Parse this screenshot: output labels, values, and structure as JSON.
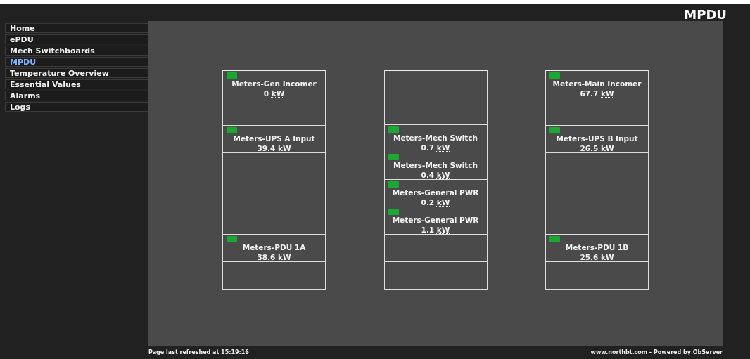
{
  "header": {
    "title": "MPDU"
  },
  "sidebar": {
    "items": [
      {
        "label": "Home",
        "selected": false
      },
      {
        "label": "ePDU",
        "selected": false
      },
      {
        "label": "Mech Switchboards",
        "selected": false
      },
      {
        "label": "MPDU",
        "selected": true
      },
      {
        "label": "Temperature Overview",
        "selected": false
      },
      {
        "label": "Essential Values",
        "selected": false
      },
      {
        "label": "Alarms",
        "selected": false
      },
      {
        "label": "Logs",
        "selected": false
      }
    ]
  },
  "columns": [
    {
      "cells": [
        {
          "kind": "meter",
          "color": "#1aa832",
          "name": "Meters-Gen Incomer",
          "value": "0",
          "unit": "kW"
        },
        {
          "kind": "empty"
        },
        {
          "kind": "meter",
          "color": "#1aa832",
          "name": "Meters-UPS A Input",
          "value": "39.4",
          "unit": "kW"
        },
        {
          "kind": "empty-triple"
        },
        {
          "kind": "meter",
          "color": "#1aa832",
          "name": "Meters-PDU 1A",
          "value": "38.6",
          "unit": "kW"
        },
        {
          "kind": "empty"
        }
      ]
    },
    {
      "cells": [
        {
          "kind": "empty-double"
        },
        {
          "kind": "meter",
          "color": "#1aa832",
          "name": "Meters-Mech Switch",
          "value": "0.7",
          "unit": "kW"
        },
        {
          "kind": "meter",
          "color": "#1aa832",
          "name": "Meters-Mech Switch",
          "value": "0.4",
          "unit": "kW"
        },
        {
          "kind": "meter",
          "color": "#1aa832",
          "name": "Meters-General PWR",
          "value": "0.2",
          "unit": "kW"
        },
        {
          "kind": "meter",
          "color": "#1aa832",
          "name": "Meters-General PWR",
          "value": "1.1",
          "unit": "kW"
        },
        {
          "kind": "empty"
        },
        {
          "kind": "empty"
        }
      ]
    },
    {
      "cells": [
        {
          "kind": "meter",
          "color": "#1aa832",
          "name": "Meters-Main Incomer",
          "value": "67.7",
          "unit": "kW"
        },
        {
          "kind": "empty"
        },
        {
          "kind": "meter",
          "color": "#1aa832",
          "name": "Meters-UPS B Input",
          "value": "26.5",
          "unit": "kW"
        },
        {
          "kind": "empty-triple"
        },
        {
          "kind": "meter",
          "color": "#1aa832",
          "name": "Meters-PDU 1B",
          "value": "25.6",
          "unit": "kW"
        },
        {
          "kind": "empty"
        }
      ]
    }
  ],
  "footer": {
    "refreshed": "Page last refreshed at 15:19:16",
    "link": "www.northbt.com",
    "credit": " - Powered by ObServer"
  }
}
